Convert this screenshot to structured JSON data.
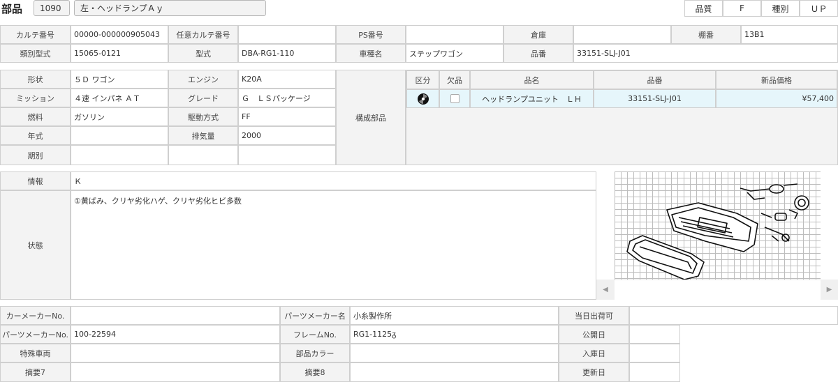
{
  "header": {
    "title": "部品",
    "code": "1090",
    "part_name": "左・ヘッドランプＡｙ",
    "quality_label": "品質",
    "quality_value": "F",
    "type_label": "種別",
    "type_value": "ＵＰ"
  },
  "row1": {
    "karte_label": "カルテ番号",
    "karte_value": "00000-000000905043",
    "nini_label": "任意カルテ番号",
    "nini_value": "",
    "ps_label": "PS番号",
    "ps_value": "",
    "warehouse_label": "倉庫",
    "warehouse_value": "",
    "shelf_label": "棚番",
    "shelf_value": "13B1"
  },
  "row2": {
    "ruibetsu_label": "類別型式",
    "ruibetsu_value": "15065-0121",
    "katashiki_label": "型式",
    "katashiki_value": "DBA-RG1-110",
    "car_label": "車種名",
    "car_value": "ステップワゴン",
    "hinban_label": "品番",
    "hinban_value": "33151-SLJ-J01"
  },
  "spec": {
    "shape_label": "形状",
    "shape_value": "５Ｄ ワゴン",
    "engine_label": "エンジン",
    "engine_value": "K20A",
    "mission_label": "ミッション",
    "mission_value": "４速 インパネ ＡＴ",
    "grade_label": "グレード",
    "grade_value": "Ｇ　ＬＳパッケージ",
    "fuel_label": "燃料",
    "fuel_value": "ガソリン",
    "drive_label": "駆動方式",
    "drive_value": "FF",
    "year_label": "年式",
    "year_value": "",
    "displacement_label": "排気量",
    "displacement_value": "2000",
    "period_label": "期別",
    "period_value": "",
    "components_label": "構成部品"
  },
  "parts_table": {
    "headers": [
      "区分",
      "欠品",
      "品名",
      "品番",
      "新品価格"
    ],
    "rows": [
      {
        "icon": "disc-icon",
        "name": "ヘッドランプユニット　ＬＨ",
        "number": "33151-SLJ-J01",
        "price": "¥57,400"
      }
    ]
  },
  "info": {
    "info_label": "情報",
    "info_value": "Ｋ",
    "state_label": "状態",
    "state_value": "①黄ばみ、クリヤ劣化ハゲ、クリヤ劣化ヒビ多数"
  },
  "bottom": {
    "car_maker_label": "カーメーカーNo.",
    "car_maker_value": "",
    "parts_maker_name_label": "パーツメーカー名",
    "parts_maker_name_value": "小糸製作所",
    "today_label": "当日出荷可",
    "today_value": "",
    "parts_maker_no_label": "パーツメーカーNo.",
    "parts_maker_no_value": "100-22594",
    "frame_label": "フレームNo.",
    "frame_value": "RG1-1125ᵹ",
    "public_label": "公開日",
    "public_value": "",
    "special_label": "特殊車両",
    "special_value": "",
    "color_label": "部品カラー",
    "color_value": "",
    "arrival_label": "入庫日",
    "arrival_value": "",
    "memo7_label": "摘要7",
    "memo7_value": "",
    "memo8_label": "摘要8",
    "memo8_value": "",
    "update_label": "更新日",
    "update_value": ""
  }
}
